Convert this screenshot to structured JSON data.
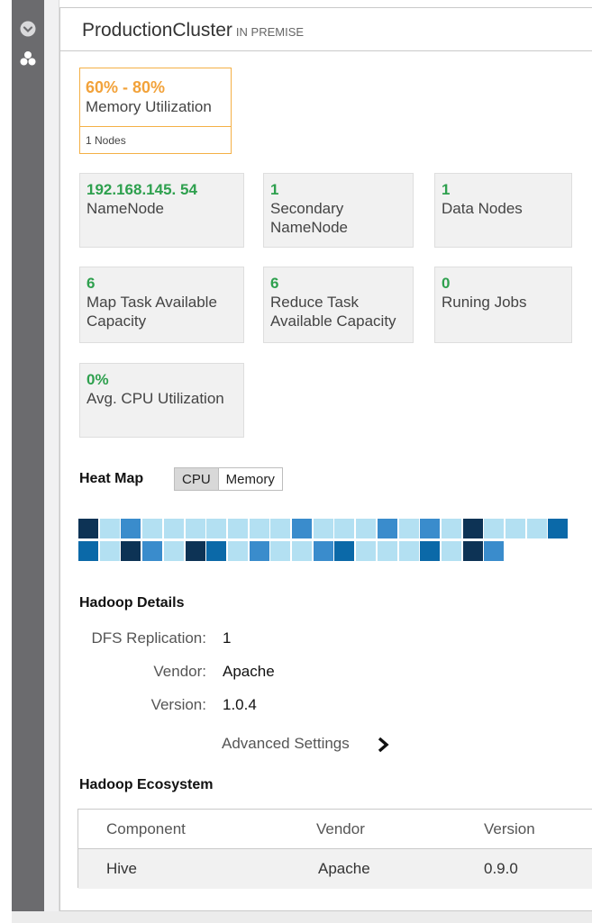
{
  "panel": {
    "cluster_name": "ProductionCluster",
    "cluster_tag": "IN PREMISE"
  },
  "memory": {
    "value": "60% - 80%",
    "label": "Memory Utilization",
    "footer": "1 Nodes",
    "color": "#f2a23a"
  },
  "tiles": {
    "namenode": {
      "value": "192.168.145. 54",
      "label": "NameNode"
    },
    "secondary": {
      "value": "1",
      "label_line1": "Secondary",
      "label_line2": "NameNode"
    },
    "datanodes": {
      "value": "1",
      "label": "Data Nodes"
    },
    "map_task": {
      "value": "6",
      "label_line1": "Map Task Available",
      "label_line2": "Capacity"
    },
    "reduce_task": {
      "value": "6",
      "label_line1": "Reduce Task",
      "label_line2": "Available Capacity"
    },
    "jobs": {
      "value": "0",
      "label": "Runing Jobs"
    },
    "cpu": {
      "value": "0%",
      "label": "Avg. CPU Utilization"
    },
    "value_color": "#2ea04e"
  },
  "heatmap": {
    "title": "Heat Map",
    "toggle_cpu": "CPU",
    "toggle_memory": "Memory",
    "selected": "CPU",
    "palette": {
      "l": "#b3e0f2",
      "m": "#3a8ccc",
      "d": "#0b69a8",
      "k": "#0d3355"
    },
    "rows": [
      [
        "k",
        "l",
        "m",
        "l",
        "l",
        "l",
        "l",
        "l",
        "l",
        "l",
        "m",
        "l",
        "l",
        "l",
        "m",
        "l",
        "m",
        "l",
        "k",
        "l",
        "l",
        "l",
        "d"
      ],
      [
        "d",
        "l",
        "k",
        "m",
        "l",
        "k",
        "d",
        "l",
        "m",
        "l",
        "l",
        "m",
        "d",
        "l",
        "l",
        "l",
        "d",
        "l",
        "k",
        "m"
      ]
    ]
  },
  "hadoop": {
    "title": "Hadoop Details",
    "dfs_label": "DFS Replication:",
    "dfs_value": "1",
    "vendor_label": "Vendor:",
    "vendor_value": "Apache",
    "version_label": "Version:",
    "version_value": "1.0.4",
    "advanced": "Advanced Settings"
  },
  "ecosystem": {
    "title": "Hadoop Ecosystem",
    "columns": [
      "Component",
      "Vendor",
      "Version"
    ],
    "rows": [
      [
        "Hive",
        "Apache",
        "0.9.0"
      ]
    ]
  }
}
